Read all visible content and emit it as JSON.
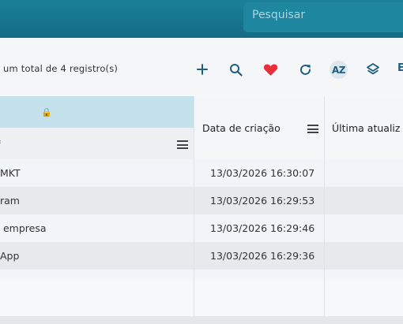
{
  "search": {
    "placeholder": "Pesquisar"
  },
  "toolbar": {
    "total_text": "um total de 4 registro(s)",
    "buttons": [
      {
        "name": "add",
        "icon": "plus-icon"
      },
      {
        "name": "search",
        "icon": "search-icon"
      },
      {
        "name": "favorites",
        "icon": "heart-icon",
        "color": "#e8303a"
      },
      {
        "name": "refresh",
        "icon": "refresh-icon"
      },
      {
        "name": "sort",
        "icon": "az-sort-icon",
        "label": "AZ"
      },
      {
        "name": "layers",
        "icon": "layers-icon"
      },
      {
        "name": "more",
        "label": "E"
      }
    ]
  },
  "table": {
    "columns": [
      {
        "label": "",
        "icon": "lock-icon"
      },
      {
        "label": "Data de criação"
      },
      {
        "label": "Última atualiz"
      }
    ],
    "rows": [
      {
        "name": "MKT",
        "created": "13/03/2026 16:30:07"
      },
      {
        "name": "ram",
        "created": "13/03/2026 16:29:53"
      },
      {
        "name": " empresa",
        "created": "13/03/2026 16:29:46"
      },
      {
        "name": "App",
        "created": "13/03/2026 16:29:36"
      }
    ]
  },
  "colors": {
    "header_bar": "#17748d",
    "accent": "#1d5f7f",
    "selected_column": "#c4e1ec"
  }
}
